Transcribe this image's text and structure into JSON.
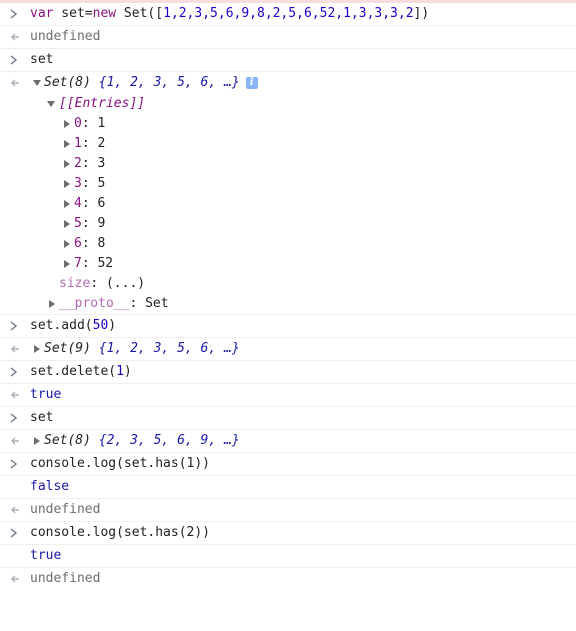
{
  "console": {
    "entry1_input": "var set=new Set([1,2,3,5,6,9,8,2,5,6,52,1,3,3,3,2])",
    "entry1_input_parts": {
      "kw": "var",
      "rest1": " set=",
      "new_kw": "new",
      "rest2": " Set([",
      "nums": "1,2,3,5,6,9,8,2,5,6,52,1,3,3,3,2",
      "close": "])"
    },
    "entry1_output": "undefined",
    "entry2_input": "set",
    "set_summary_label": "Set(8)",
    "set_summary_values": "{1, 2, 3, 5, 6, …}",
    "info_badge": "i",
    "entries_label": "[[Entries]]",
    "entries": [
      {
        "key": "0",
        "value": "1"
      },
      {
        "key": "1",
        "value": "2"
      },
      {
        "key": "2",
        "value": "3"
      },
      {
        "key": "3",
        "value": "5"
      },
      {
        "key": "4",
        "value": "6"
      },
      {
        "key": "5",
        "value": "9"
      },
      {
        "key": "6",
        "value": "8"
      },
      {
        "key": "7",
        "value": "52"
      }
    ],
    "size_label": "size",
    "size_value": "(...)",
    "proto_label": "__proto__",
    "proto_value": "Set",
    "entry3_input": "set.add(50)",
    "entry3_input_parts": {
      "fn": "set.add(",
      "num": "50",
      "close": ")"
    },
    "entry3_output_label": "Set(9)",
    "entry3_output_values": "{1, 2, 3, 5, 6, …}",
    "entry4_input": "set.delete(1)",
    "entry4_input_parts": {
      "fn": "set.delete(",
      "num": "1",
      "close": ")"
    },
    "entry4_output": "true",
    "entry5_input": "set",
    "entry5_output_label": "Set(8)",
    "entry5_output_values": "{2, 3, 5, 6, 9, …}",
    "entry6_input": "console.log(set.has(1))",
    "entry6_log": "false",
    "entry6_output": "undefined",
    "entry7_input": "console.log(set.has(2))",
    "entry7_log": "true",
    "entry7_output": "undefined"
  },
  "colors": {
    "keyword": "#881280",
    "number": "#1c00cf",
    "boolean": "#1a1aa6",
    "gutter": "#9aa3ad"
  },
  "icons": [
    "prompt-chevron-icon",
    "result-arrow-icon",
    "expand-triangle-icon",
    "collapse-triangle-icon",
    "info-icon"
  ]
}
